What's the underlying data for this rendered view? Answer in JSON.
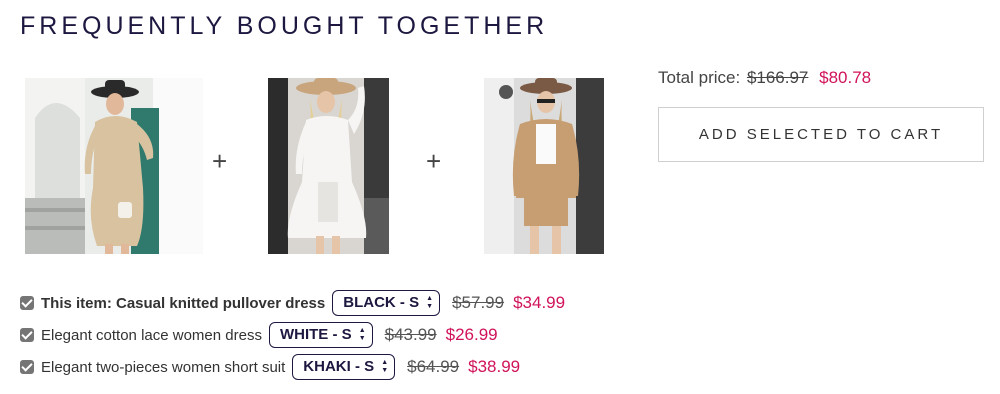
{
  "heading": "FREQUENTLY BOUGHT TOGETHER",
  "plus_symbol": "+",
  "summary": {
    "total_label": "Total price:",
    "total_old": "$166.97",
    "total_new": "$80.78",
    "add_button": "ADD SELECTED TO CART"
  },
  "items": [
    {
      "name": "This item: Casual knitted pullover dress",
      "variant": "BLACK - S",
      "old_price": "$57.99",
      "new_price": "$34.99",
      "checked": true
    },
    {
      "name": "Elegant cotton lace women dress",
      "variant": "WHITE - S",
      "old_price": "$43.99",
      "new_price": "$26.99",
      "checked": true
    },
    {
      "name": "Elegant two-pieces women short suit",
      "variant": "KHAKI - S",
      "old_price": "$64.99",
      "new_price": "$38.99",
      "checked": true
    }
  ],
  "colors": {
    "heading": "#1c1840",
    "sale": "#d0135a",
    "checkbox": "#757575"
  }
}
